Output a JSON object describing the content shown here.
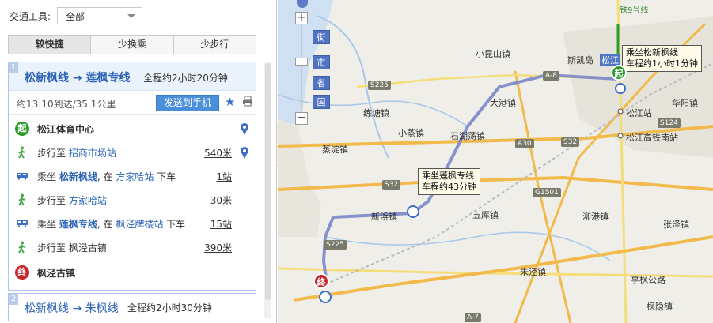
{
  "transport": {
    "label": "交通工具:",
    "selected": "全部"
  },
  "tabs": [
    {
      "label": "较快捷"
    },
    {
      "label": "少换乘"
    },
    {
      "label": "少步行"
    }
  ],
  "plan1": {
    "index": "1",
    "title": "松新枫线 → 莲枫专线",
    "total": "全程约2小时20分钟",
    "arrival": "约13:10到达/35.1公里",
    "send_label": "发送到手机",
    "steps": [
      {
        "type": "start",
        "badge": "起",
        "text": "松江体育中心"
      },
      {
        "type": "walk",
        "prefix": "步行至",
        "place": "招商市场站",
        "dist": "540米"
      },
      {
        "type": "bus",
        "prefix": "乘坐",
        "line": "松新枫线",
        "mid": ", 在",
        "stop": "方家哈站",
        "suffix": "下车",
        "dist": "1站"
      },
      {
        "type": "walk",
        "prefix": "步行至",
        "place": "方家哈站",
        "dist": "30米"
      },
      {
        "type": "bus",
        "prefix": "乘坐",
        "line": "莲枫专线",
        "mid": ", 在",
        "stop": "枫泾牌楼站",
        "suffix": "下车",
        "dist": "15站"
      },
      {
        "type": "walk",
        "prefix": "步行至",
        "place": "枫泾古镇",
        "dist": "390米"
      },
      {
        "type": "end",
        "badge": "终",
        "text": "枫泾古镇"
      }
    ]
  },
  "plan2": {
    "index": "2",
    "title": "松新枫线 → 朱枫线",
    "total": "全程约2小时30分钟"
  },
  "map": {
    "level_labels": [
      "街",
      "市",
      "省",
      "国"
    ],
    "callout1": {
      "line1": "乘坐松新枫线",
      "line2": "车程约1小时1分钟"
    },
    "callout2": {
      "line1": "乘坐莲枫专线",
      "line2": "车程约43分钟"
    },
    "start_badge": "起",
    "end_badge": "终",
    "labels": {
      "xiaokunshan": "小昆山镇",
      "sikaidao": "斯凯岛",
      "songjiang": "松江",
      "dagang": "大港镇",
      "huayang": "华阳镇",
      "songjiang_station": "松江站",
      "songjiang_south": "松江高铁南站",
      "lianqiang": "练塘镇",
      "xiaozheng": "小蒸镇",
      "shihudang": "石湖荡镇",
      "lianding": "蒸淀镇",
      "xinqi": "新浜镇",
      "wuku": "五厍镇",
      "yegang": "泖港镇",
      "zhangze": "张泽镇",
      "zhujing": "朱泾镇",
      "tingfeng": "亭枫公路",
      "fengyin": "枫隐镇",
      "metro": "铁9号线"
    },
    "shields": {
      "s225a": "S225",
      "s225b": "S225",
      "s32a": "S32",
      "s32b": "S32",
      "s124": "S124",
      "g1501": "G1501",
      "a8": "A-8",
      "a7": "A-7",
      "a30": "A30"
    }
  },
  "colors": {
    "route": "#7b86c9",
    "start": "#2e9a2e",
    "end": "#c7262c",
    "link": "#2b63b5"
  }
}
